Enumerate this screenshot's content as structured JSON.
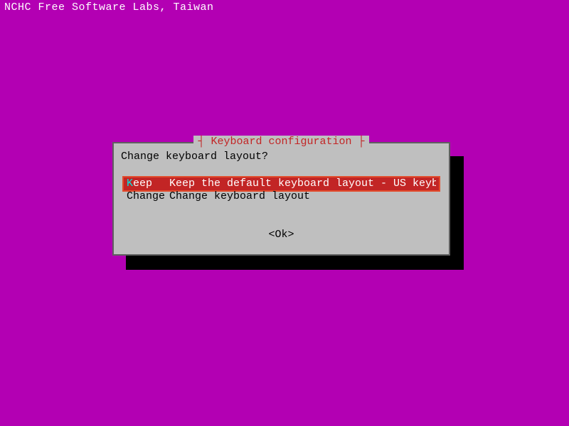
{
  "header": "NCHC Free Software Labs, Taiwan",
  "dialog": {
    "title": "Keyboard configuration",
    "prompt": "Change keyboard layout?",
    "options": [
      {
        "key_hot": "K",
        "key_rest": "eep",
        "desc": "Keep the default keyboard layout - US keyboard",
        "selected": true
      },
      {
        "key_hot": "C",
        "key_rest": "hange",
        "desc": "Change keyboard layout",
        "selected": false
      }
    ],
    "ok": "<Ok>"
  }
}
